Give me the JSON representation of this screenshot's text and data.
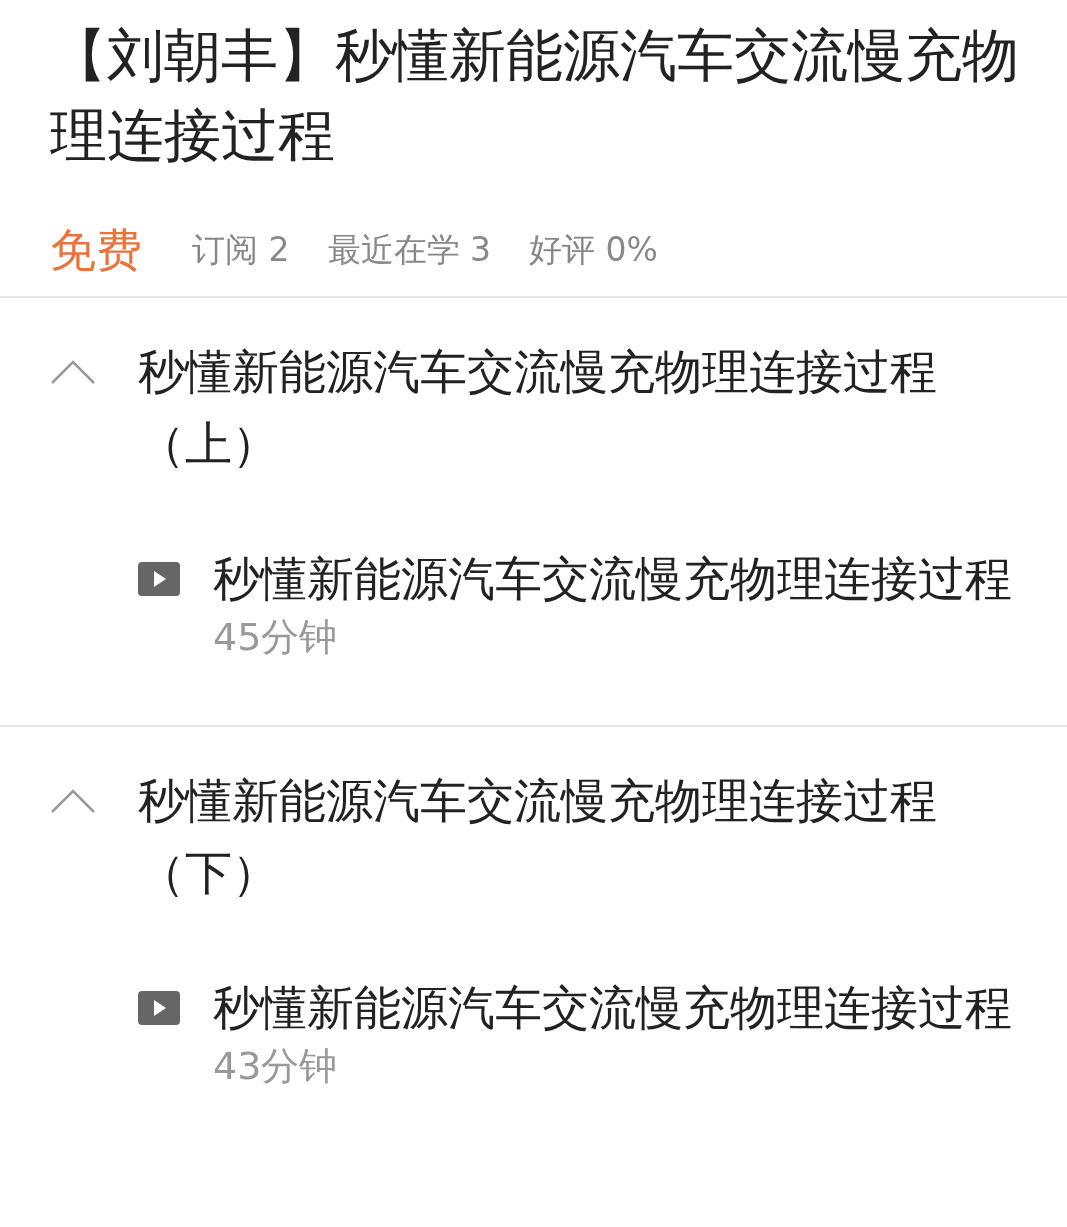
{
  "title": "【刘朝丰】秒懂新能源汽车交流慢充物理连接过程",
  "meta": {
    "price": "免费",
    "stats": [
      "订阅 2",
      "最近在学 3",
      "好评 0%"
    ]
  },
  "sections": [
    {
      "title": "秒懂新能源汽车交流慢充物理连接过程（上）",
      "expanded": true,
      "lessons": [
        {
          "title": "秒懂新能源汽车交流慢充物理连接过程",
          "duration": "45分钟"
        }
      ]
    },
    {
      "title": "秒懂新能源汽车交流慢充物理连接过程（下）",
      "expanded": true,
      "lessons": [
        {
          "title": "秒懂新能源汽车交流慢充物理连接过程",
          "duration": "43分钟"
        }
      ]
    }
  ]
}
